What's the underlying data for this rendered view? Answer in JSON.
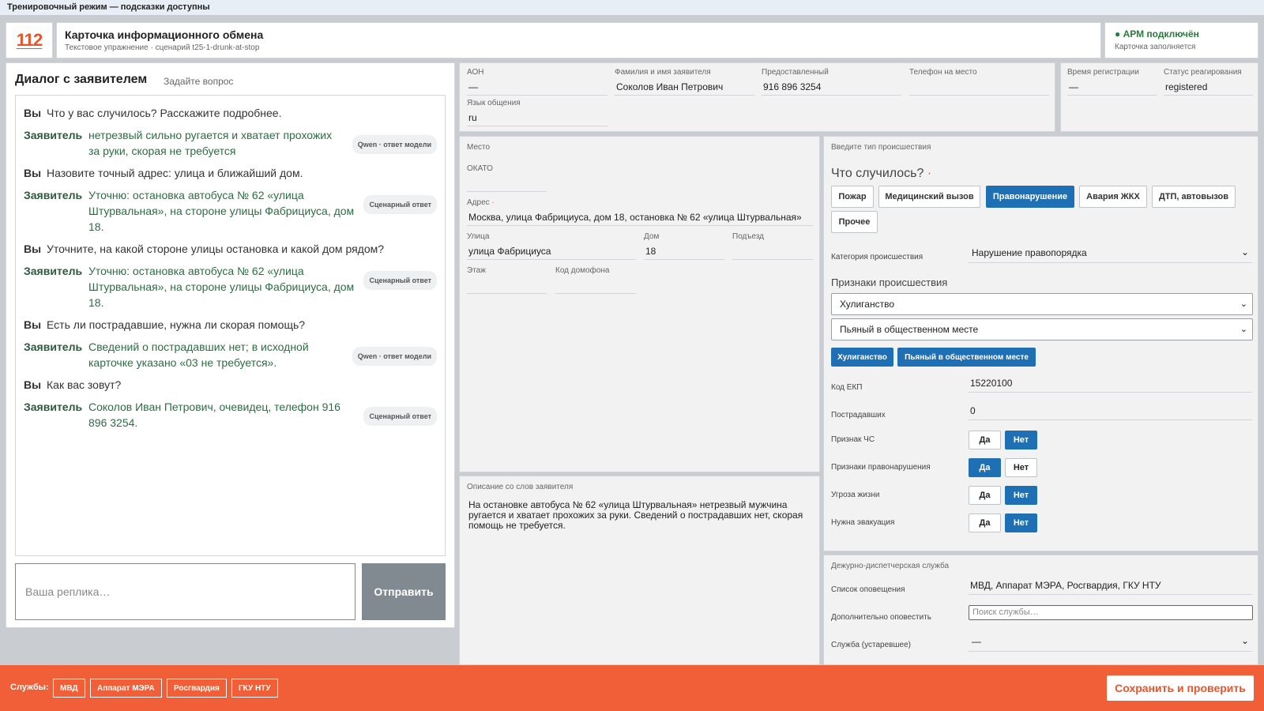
{
  "banner": "Тренировочный режим — подсказки доступны",
  "header": {
    "logo": "112",
    "title": "Карточка информационного обмена",
    "subtitle": "Текстовое упражнение · сценарий t25-1-drunk-at-stop",
    "status": "● АРМ подключён",
    "status_sub": "Карточка заполняется"
  },
  "dialog": {
    "title": "Диалог с заявителем",
    "hint": "Задайте вопрос",
    "messages": [
      {
        "who": "Вы",
        "text": "Что у вас случилось? Расскажите подробнее."
      },
      {
        "who": "Заявитель",
        "text": "нетрезвый сильно ругается и хватает прохожих за руки, скорая не требуется",
        "tag": "Qwen · ответ модели"
      },
      {
        "who": "Вы",
        "text": "Назовите точный адрес: улица и ближайший дом."
      },
      {
        "who": "Заявитель",
        "text": "Уточню: остановка автобуса № 62 «улица Штурвальная», на стороне улицы Фабрициуса, дом 18.",
        "tag": "Сценарный ответ"
      },
      {
        "who": "Вы",
        "text": "Уточните, на какой стороне улицы остановка и какой дом рядом?"
      },
      {
        "who": "Заявитель",
        "text": "Уточню: остановка автобуса № 62 «улица Штурвальная», на стороне улицы Фабрициуса, дом 18.",
        "tag": "Сценарный ответ"
      },
      {
        "who": "Вы",
        "text": "Есть ли пострадавшие, нужна ли скорая помощь?"
      },
      {
        "who": "Заявитель",
        "text": "Сведений о пострадавших нет; в исходной карточке указано «03 не требуется».",
        "tag": "Qwen · ответ модели"
      },
      {
        "who": "Вы",
        "text": "Как вас зовут?"
      },
      {
        "who": "Заявитель",
        "text": "Соколов Иван Петрович, очевидец, телефон 916 896 3254.",
        "tag": "Сценарный ответ"
      }
    ],
    "reply_placeholder": "Ваша реплика…",
    "send_label": "Отправить"
  },
  "caller": {
    "aon_label": "АОН",
    "aon": "—",
    "name_label": "Фамилия и имя заявителя",
    "name": "Соколов Иван Петрович",
    "provided_label": "Предоставленный",
    "provided": "916 896 3254",
    "phone_label": "Телефон на место",
    "phone": "",
    "lang_label": "Язык общения",
    "lang": "ru"
  },
  "registration": {
    "time_label": "Время регистрации",
    "time": "—",
    "status_label": "Статус реагирования",
    "status": "registered"
  },
  "place": {
    "title": "Место",
    "okato_label": "ОКАТО",
    "okato": "",
    "address_label": "Адрес",
    "address_mark": "·",
    "address": "Москва, улица Фабрициуса, дом 18, остановка № 62 «улица Штурвальная»",
    "street_label": "Улица",
    "street": "улица Фабрициуса",
    "house_label": "Дом",
    "house": "18",
    "entrance_label": "Подъезд",
    "entrance": "",
    "floor_label": "Этаж",
    "floor": "",
    "intercom_label": "Код домофона",
    "intercom": ""
  },
  "description": {
    "title": "Описание со слов заявителя",
    "text": "На остановке автобуса № 62 «улица Штурвальная» нетрезвый мужчина ругается и хватает прохожих за руки. Сведений о пострадавших нет, скорая помощь не требуется."
  },
  "incident": {
    "section_title": "Введите тип происшествия",
    "question": "Что случилось?",
    "question_mark": "·",
    "types": [
      "Пожар",
      "Медицинский вызов",
      "Правонарушение",
      "Авария ЖКХ",
      "ДТП, автовызов",
      "Прочее"
    ],
    "selected_type": "Правонарушение",
    "category_label": "Категория происшествия",
    "category": "Нарушение правопорядка",
    "signs_title": "Признаки происшествия",
    "sign1": "Хулиганство",
    "sign2": "Пьяный в общественном месте",
    "chips": [
      "Хулиганство",
      "Пьяный в общественном месте"
    ],
    "ekp_label": "Код ЕКП",
    "ekp": "15220100",
    "victims_label": "Пострадавших",
    "victims": "0",
    "yes": "Да",
    "no": "Нет",
    "flags": [
      {
        "label": "Признак ЧС",
        "value": "Нет"
      },
      {
        "label": "Признаки правонарушения",
        "value": "Да"
      },
      {
        "label": "Угроза жизни",
        "value": "Нет"
      },
      {
        "label": "Нужна эвакуация",
        "value": "Нет"
      }
    ]
  },
  "dispatch": {
    "title": "Дежурно-диспетчерская служба",
    "list_label": "Список оповещения",
    "list": "МВД, Аппарат МЭРА, Росгвардия, ГКУ НТУ",
    "extra_label": "Дополнительно оповестить",
    "extra_placeholder": "Поиск службы…",
    "legacy_label": "Служба (устаревшее)",
    "legacy": "—"
  },
  "footer": {
    "label": "Службы:",
    "services": [
      "МВД",
      "Аппарат МЭРА",
      "Росгвардия",
      "ГКУ НТУ"
    ],
    "save_label": "Сохранить и проверить"
  },
  "colors": {
    "accent": "#f05f37",
    "primary": "#1e6fb3",
    "status_ok": "#2b7a3a"
  }
}
